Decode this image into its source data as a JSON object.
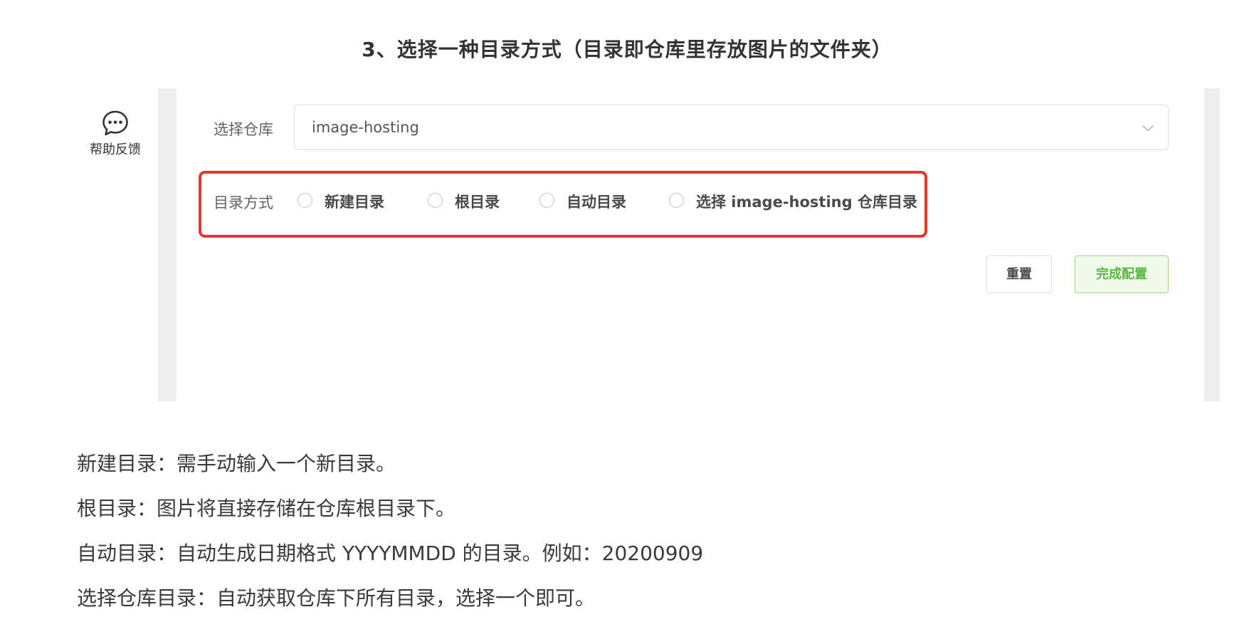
{
  "step_heading": "3、选择一种目录方式（目录即仓库里存放图片的文件夹）",
  "sidebar": {
    "help_icon": "chat-bubble-icon",
    "help_label": "帮助反馈"
  },
  "form": {
    "repo_label": "选择仓库",
    "repo_value": "image-hosting",
    "repo_dropdown_icon": "chevron-down-icon",
    "dir_mode_label": "目录方式",
    "dir_mode_options": [
      {
        "label": "新建目录",
        "selected": false
      },
      {
        "label": "根目录",
        "selected": false
      },
      {
        "label": "自动目录",
        "selected": false
      },
      {
        "label": "选择 image-hosting 仓库目录",
        "selected": false
      }
    ],
    "reset_label": "重置",
    "done_label": "完成配置"
  },
  "descriptions": [
    "新建目录：需手动输入一个新目录。",
    "根目录：图片将直接存储在仓库根目录下。",
    "自动目录：自动生成日期格式 YYYYMMDD 的目录。例如：20200909",
    "选择仓库目录：自动获取仓库下所有目录，选择一个即可。"
  ],
  "colors": {
    "highlight_border": "#e8372d",
    "done_button_text": "#59b840",
    "done_button_bg": "#effaea",
    "gutter": "#eeeeee"
  }
}
